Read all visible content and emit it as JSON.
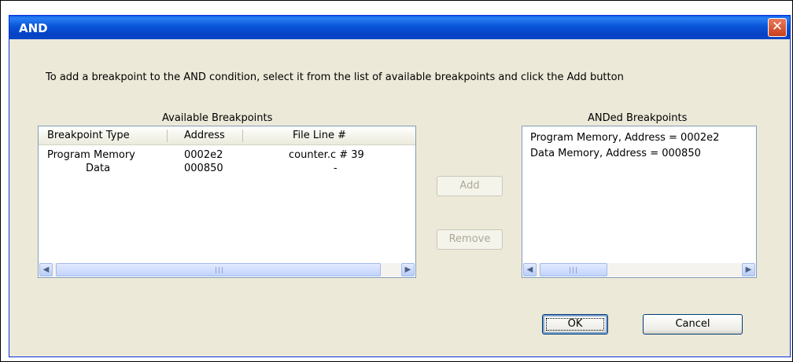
{
  "dialog": {
    "title": "AND",
    "close_glyph": "✕"
  },
  "instructions": "To add a breakpoint to the AND condition, select it from the list of available breakpoints and click the Add button",
  "available": {
    "label": "Available Breakpoints",
    "columns": [
      "Breakpoint Type",
      "Address",
      "File Line #"
    ],
    "rows": [
      [
        "Program Memory",
        "0002e2",
        "counter.c # 39"
      ],
      [
        "Data",
        "000850",
        "-"
      ]
    ]
  },
  "anded": {
    "label": "ANDed Breakpoints",
    "items": [
      "Program Memory, Address = 0002e2",
      "Data Memory, Address = 000850"
    ]
  },
  "buttons": {
    "add": "Add",
    "remove": "Remove",
    "ok": "OK",
    "cancel": "Cancel"
  },
  "scroll": {
    "left_glyph": "◀",
    "right_glyph": "▶"
  }
}
